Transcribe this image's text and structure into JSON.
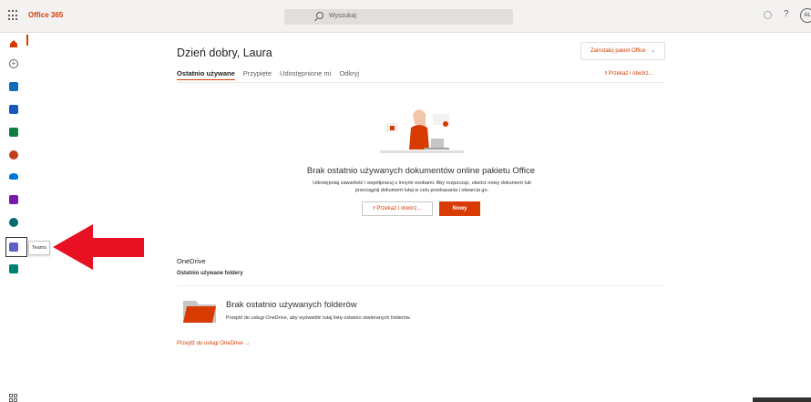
{
  "topbar": {
    "brand": "Office 365",
    "search_placeholder": "Wyszukaj",
    "avatar_initials": "AL"
  },
  "rail": {
    "apps": [
      {
        "name": "home",
        "color": "#d83b01"
      },
      {
        "name": "create",
        "color": "#605e5c"
      },
      {
        "name": "outlook",
        "color": "#0f6cbd"
      },
      {
        "name": "word",
        "color": "#185abd"
      },
      {
        "name": "excel",
        "color": "#107c41"
      },
      {
        "name": "powerpoint",
        "color": "#c43e1c"
      },
      {
        "name": "onedrive",
        "color": "#0078d4"
      },
      {
        "name": "onenote",
        "color": "#7719aa"
      },
      {
        "name": "sharepoint",
        "color": "#036c70"
      },
      {
        "name": "teams",
        "color": "#5b5fc7"
      },
      {
        "name": "sway",
        "color": "#008272"
      }
    ],
    "tooltip": "Teams"
  },
  "main": {
    "greeting": "Dzień dobry, Laura",
    "install_button": "Zainstaluj pakiet Office",
    "tabs": [
      "Ostatnio używane",
      "Przypięte",
      "Udostępnione mi",
      "Odkryj"
    ],
    "upload_open": "Przekaż i otwórz...",
    "empty_title": "Brak ostatnio używanych dokumentów online pakietu Office",
    "empty_subtitle": "Udostępniaj zawartość i współpracuj z innymi osobami. Aby rozpocząć, utwórz nowy dokument lub przeciągnij dokument tutaj w celu przekazania i otwarcia go.",
    "btn_upload": "Przekaż i otwórz...",
    "btn_new": "Nowy"
  },
  "onedrive": {
    "title": "OneDrive",
    "subtitle": "Ostatnio używane foldery",
    "empty_title": "Brak ostatnio używanych folderów",
    "empty_subtitle": "Przejdź do usługi OneDrive, aby wyświetlić tutaj listę ostatnio otwieranych folderów.",
    "link": "Przejdź do usługi OneDrive →"
  },
  "colors": {
    "accent": "#d83b01",
    "arrow": "#e81123"
  }
}
